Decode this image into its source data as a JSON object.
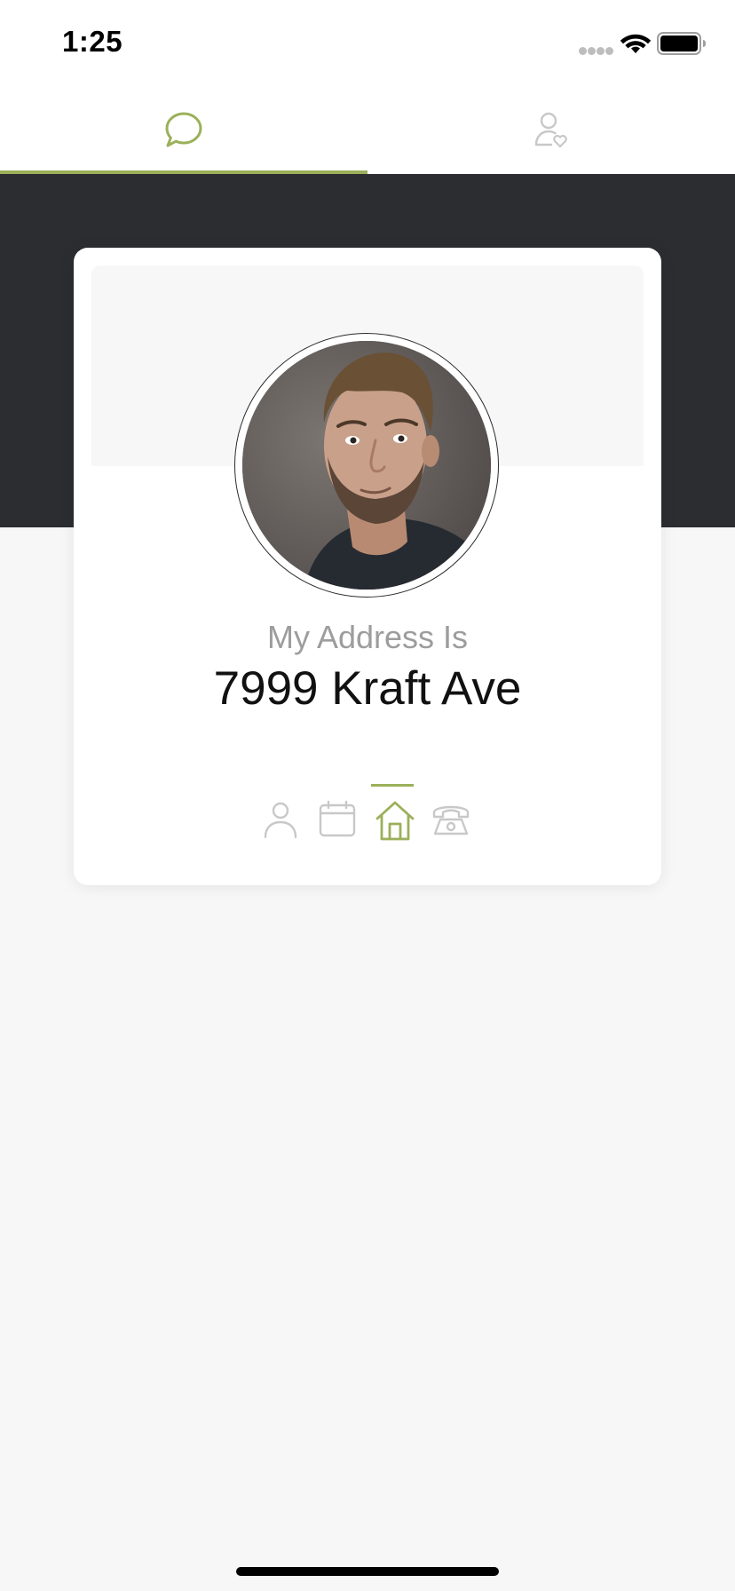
{
  "status_bar": {
    "time": "1:25"
  },
  "top_tabs": [
    {
      "icon": "chat-bubble-icon",
      "active": true
    },
    {
      "icon": "user-heart-icon",
      "active": false
    }
  ],
  "card": {
    "avatar": "profile-photo",
    "label": "My Address Is",
    "value": "7999 Kraft Ave",
    "info_tabs": [
      {
        "icon": "person-icon",
        "active": false
      },
      {
        "icon": "calendar-icon",
        "active": false
      },
      {
        "icon": "home-icon",
        "active": true
      },
      {
        "icon": "telephone-icon",
        "active": false
      }
    ]
  },
  "colors": {
    "accent": "#9bb05a",
    "dark_band": "#2c2d31",
    "inactive_icon": "#c8c8c8",
    "label_gray": "#9d9d9d"
  }
}
